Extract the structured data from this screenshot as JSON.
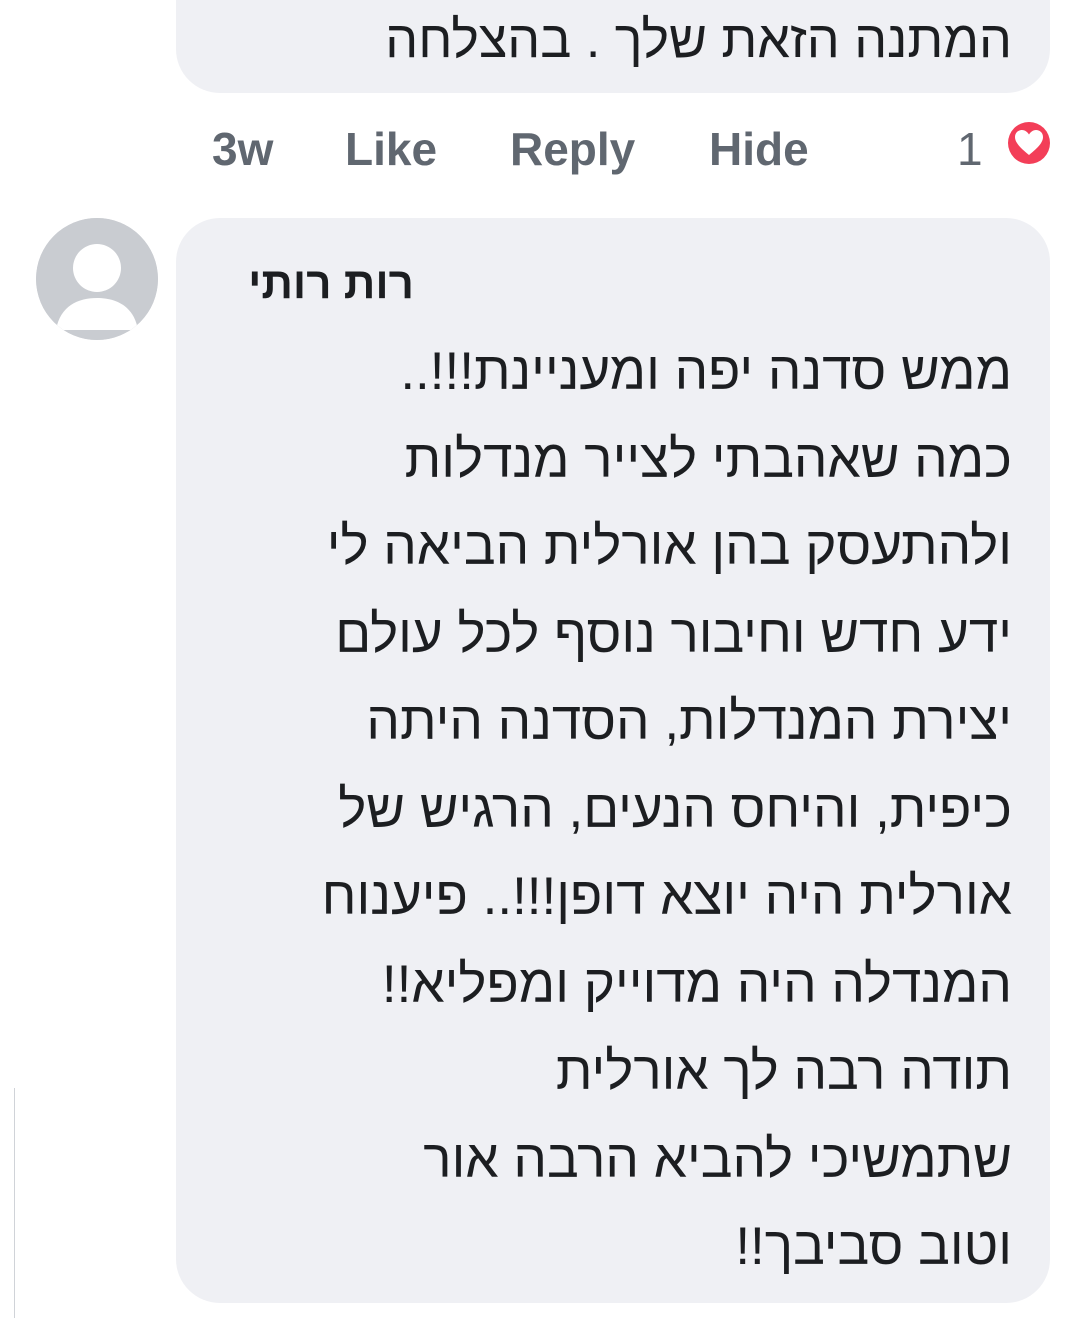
{
  "previous_comment": {
    "text_end": "המתנה הזאת שלך . בהצלחה"
  },
  "previous_comment_actions": {
    "time": "3w",
    "like": "Like",
    "reply": "Reply",
    "hide": "Hide",
    "reaction_count": "1",
    "reaction_icon": "heart-icon",
    "reaction_color": "#f33e58"
  },
  "comment": {
    "author": "רות רותי",
    "lines": [
      "ממש סדנה יפה ומעניינת!!!..",
      "כמה שאהבתי לצייר מנדלות",
      "ולהתעסק בהן אורלית הביאה לי",
      "ידע חדש וחיבור נוסף לכל עולם",
      "יצירת המנדלות, הסדנה היתה",
      "כיפית, והיחס הנעים, הרגיש של",
      "אורלית היה יוצא דופן!!!.. פיענוח",
      "המנדלה היה מדוייק ומפליא!!",
      "תודה רבה לך אורלית",
      "שתמשיכי להביא הרבה אור",
      "וטוב סביבך!!"
    ]
  },
  "colors": {
    "bubble": "#eff0f4",
    "text": "#1c1e21",
    "meta": "#606770",
    "avatar": "#c9ccd1"
  }
}
